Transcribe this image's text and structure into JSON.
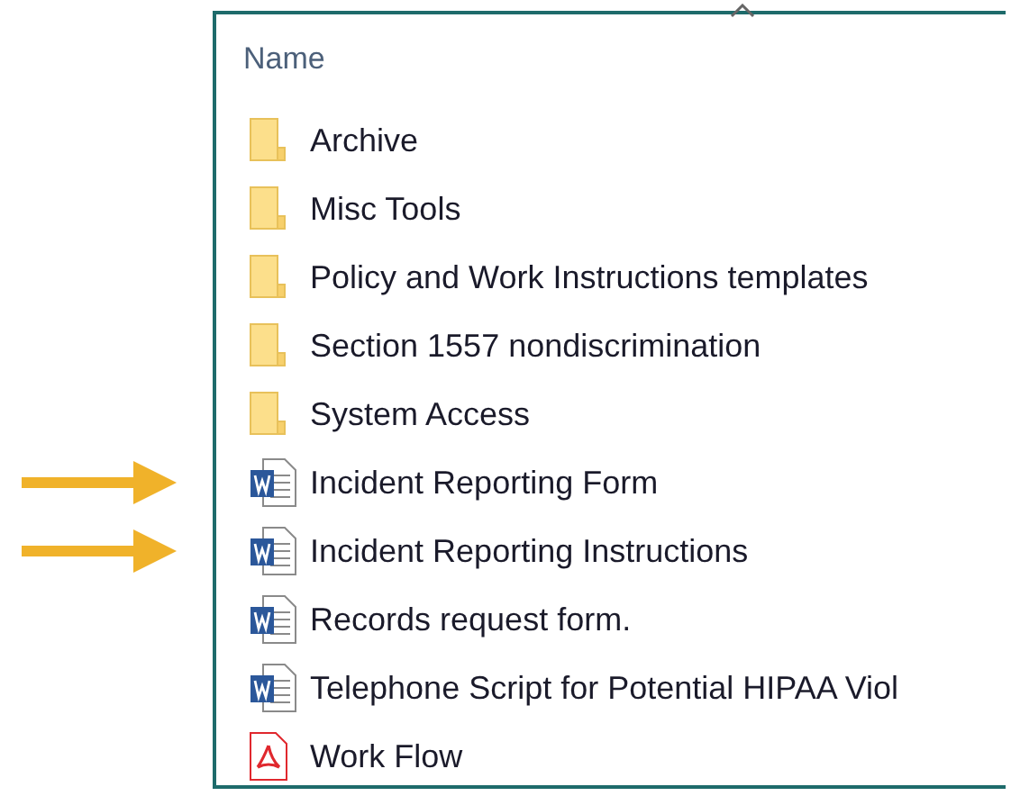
{
  "column_header": {
    "label": "Name",
    "sorted": true
  },
  "items": [
    {
      "name": "Archive",
      "kind": "folder",
      "marked": false
    },
    {
      "name": "Misc Tools",
      "kind": "folder",
      "marked": false
    },
    {
      "name": "Policy and Work Instructions templates",
      "kind": "folder",
      "marked": false
    },
    {
      "name": "Section 1557 nondiscrimination",
      "kind": "folder",
      "marked": false
    },
    {
      "name": "System Access",
      "kind": "folder",
      "marked": false
    },
    {
      "name": "Incident Reporting Form",
      "kind": "word",
      "marked": true
    },
    {
      "name": "Incident Reporting Instructions",
      "kind": "word",
      "marked": true
    },
    {
      "name": "Records request form.",
      "kind": "word",
      "marked": false
    },
    {
      "name": "Telephone Script for Potential HIPAA Viol",
      "kind": "word",
      "marked": false
    },
    {
      "name": "Work Flow",
      "kind": "pdf",
      "marked": false
    }
  ]
}
